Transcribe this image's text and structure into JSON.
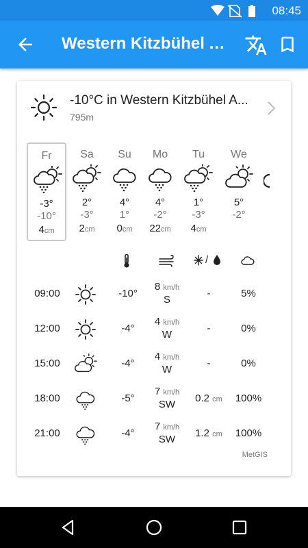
{
  "status_bar": {
    "time": "08:45"
  },
  "app_bar": {
    "title": "Western Kitzbühel A..."
  },
  "location": {
    "title": "-10°C in Western Kitzbühel A...",
    "altitude": "795m"
  },
  "days": [
    {
      "name": "Fr",
      "icon": "partly-cloudy-snow-icon",
      "max": "-3°",
      "min": "-10°",
      "snow": "4",
      "snow_unit": "cm"
    },
    {
      "name": "Sa",
      "icon": "partly-cloudy-snow-icon",
      "max": "2°",
      "min": "-3°",
      "snow": "2",
      "snow_unit": "cm"
    },
    {
      "name": "Su",
      "icon": "cloud-snow-icon",
      "max": "4°",
      "min": "1°",
      "snow": "0",
      "snow_unit": "cm"
    },
    {
      "name": "Mo",
      "icon": "cloud-snow-icon",
      "max": "4°",
      "min": "-2°",
      "snow": "22",
      "snow_unit": "cm"
    },
    {
      "name": "Tu",
      "icon": "partly-cloudy-snow-icon",
      "max": "1°",
      "min": "-3°",
      "snow": "4",
      "snow_unit": "cm"
    },
    {
      "name": "We",
      "icon": "partly-cloudy-icon",
      "max": "5°",
      "min": "-2°",
      "snow": "",
      "snow_unit": ""
    }
  ],
  "hourly_headers": {
    "temperature": "thermometer-icon",
    "wind": "wind-icon",
    "precip_separator": "/",
    "precipitation": "snow-rain-icon",
    "cloud": "cloud-icon"
  },
  "hourly": [
    {
      "time": "09:00",
      "icon": "sun-icon",
      "temp": "-10°",
      "wind_speed": "8",
      "wind_unit": "km/h",
      "wind_dir": "S",
      "precip": "-",
      "precip_unit": "",
      "cloud": "5%"
    },
    {
      "time": "12:00",
      "icon": "sun-icon",
      "temp": "-4°",
      "wind_speed": "4",
      "wind_unit": "km/h",
      "wind_dir": "W",
      "precip": "-",
      "precip_unit": "",
      "cloud": "0%"
    },
    {
      "time": "15:00",
      "icon": "partly-cloudy-icon",
      "temp": "-4°",
      "wind_speed": "4",
      "wind_unit": "km/h",
      "wind_dir": "W",
      "precip": "-",
      "precip_unit": "",
      "cloud": "0%"
    },
    {
      "time": "18:00",
      "icon": "cloud-snow-icon",
      "temp": "-5°",
      "wind_speed": "7",
      "wind_unit": "km/h",
      "wind_dir": "SW",
      "precip": "0.2",
      "precip_unit": "cm",
      "cloud": "100%"
    },
    {
      "time": "21:00",
      "icon": "cloud-snow-icon",
      "temp": "-4°",
      "wind_speed": "7",
      "wind_unit": "km/h",
      "wind_dir": "SW",
      "precip": "1.2",
      "precip_unit": "cm",
      "cloud": "100%"
    }
  ],
  "source": "MetGIS",
  "colors": {
    "app_bar": "#2196f3",
    "status_bar": "#1e88e5",
    "nav_bar": "#000000"
  }
}
